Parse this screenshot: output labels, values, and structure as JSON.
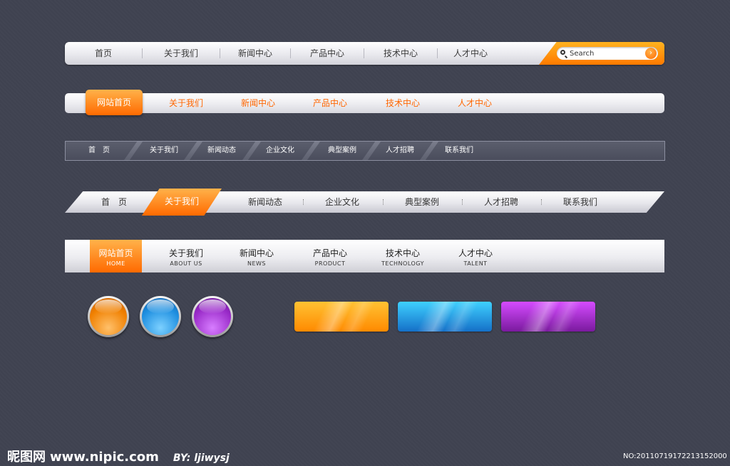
{
  "nav1": {
    "items": [
      "首页",
      "关于我们",
      "新闻中心",
      "产品中心",
      "技术中心",
      "人才中心"
    ],
    "search_placeholder": "Search",
    "go_glyph": "›",
    "accent": "#ff8a00"
  },
  "nav2": {
    "active": "网站首页",
    "items": [
      "关于我们",
      "新闻中心",
      "产品中心",
      "技术中心",
      "人才中心"
    ],
    "text_color": "#ff6600"
  },
  "nav3": {
    "items": [
      "首　页",
      "关于我们",
      "新闻动态",
      "企业文化",
      "典型案例",
      "人才招聘",
      "联系我们"
    ]
  },
  "nav4": {
    "items": [
      "首　页",
      "关于我们",
      "新闻动态",
      "企业文化",
      "典型案例",
      "人才招聘",
      "联系我们"
    ],
    "active_index": 1
  },
  "nav5": {
    "items": [
      {
        "zh": "网站首页",
        "en": "HOME"
      },
      {
        "zh": "关于我们",
        "en": "ABOUT US"
      },
      {
        "zh": "新闻中心",
        "en": "NEWS"
      },
      {
        "zh": "产品中心",
        "en": "PRODUCT"
      },
      {
        "zh": "技术中心",
        "en": "TECHNOLOGY"
      },
      {
        "zh": "人才中心",
        "en": "TALENT"
      }
    ]
  },
  "orbs": [
    {
      "name": "orange",
      "color": "#ff8a00"
    },
    {
      "name": "blue",
      "color": "#1e8fe0"
    },
    {
      "name": "purple",
      "color": "#9a2bc9"
    }
  ],
  "buttons": [
    {
      "name": "orange",
      "color": "#ff9800"
    },
    {
      "name": "blue",
      "color": "#1fa2e8"
    },
    {
      "name": "purple",
      "color": "#b71fd6"
    }
  ],
  "footer": {
    "logo": "昵图网",
    "url": "www.nipic.com",
    "by": "BY: ljiwysj",
    "number": "NO:20110719172213152000"
  }
}
